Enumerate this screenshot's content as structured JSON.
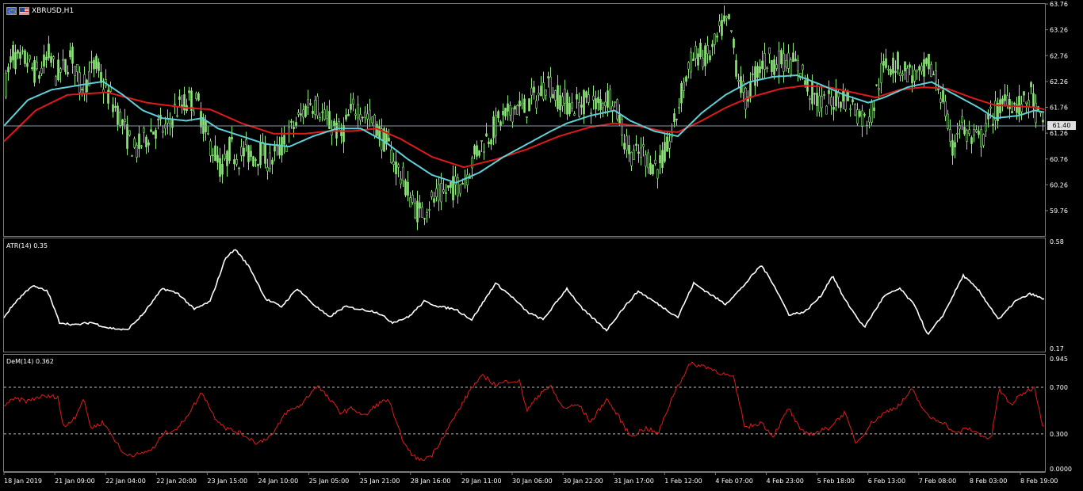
{
  "window": {
    "title": "XBRUSD,H1",
    "icons": [
      "chart-flag-eu-icon",
      "chart-flag-us-icon"
    ]
  },
  "colors": {
    "background": "#000000",
    "candles": "#8ee87a",
    "ma_fast": "#5fd0d8",
    "ma_slow": "#e01a1a",
    "atr": "#ffffff",
    "dem": "#e01a1a",
    "grid": "#7a7a7a",
    "axis_text": "#ffffff"
  },
  "price_panel": {
    "current_price": "61.40",
    "ticks": [
      "63.76",
      "63.26",
      "62.76",
      "62.26",
      "61.76",
      "61.26",
      "60.76",
      "60.26",
      "59.76"
    ]
  },
  "atr_panel": {
    "label": "ATR(14) 0.35",
    "ticks": [
      "0.58",
      "0.17"
    ]
  },
  "dem_panel": {
    "label": "DeM(14) 0.362",
    "ticks": [
      "0.945",
      "0.700",
      "0.300",
      "0.0000"
    ],
    "levels": [
      0.7,
      0.3
    ]
  },
  "time_axis": [
    "18 Jan 2019",
    "21 Jan 09:00",
    "22 Jan 04:00",
    "22 Jan 20:00",
    "23 Jan 15:00",
    "24 Jan 10:00",
    "25 Jan 05:00",
    "25 Jan 21:00",
    "28 Jan 16:00",
    "29 Jan 11:00",
    "30 Jan 06:00",
    "30 Jan 22:00",
    "31 Jan 17:00",
    "1 Feb 12:00",
    "4 Feb 07:00",
    "4 Feb 23:00",
    "5 Feb 18:00",
    "6 Feb 13:00",
    "7 Feb 08:00",
    "8 Feb 03:00",
    "8 Feb 19:00"
  ],
  "chart_data": {
    "type": "line",
    "price_axis": [
      59.76,
      63.76
    ],
    "price_anchors": [
      [
        0,
        61.6
      ],
      [
        8,
        62.3
      ],
      [
        16,
        62.8
      ],
      [
        24,
        62.6
      ],
      [
        32,
        62.7
      ],
      [
        40,
        62.5
      ],
      [
        48,
        62.4
      ],
      [
        56,
        62.6
      ],
      [
        62,
        62.8
      ],
      [
        70,
        62.4
      ],
      [
        80,
        62.5
      ],
      [
        90,
        62.8
      ],
      [
        100,
        62.2
      ],
      [
        110,
        62.3
      ],
      [
        120,
        62.6
      ],
      [
        130,
        62.2
      ],
      [
        140,
        61.9
      ],
      [
        150,
        61.6
      ],
      [
        160,
        61.2
      ],
      [
        170,
        60.9
      ],
      [
        180,
        61.1
      ],
      [
        190,
        61.3
      ],
      [
        200,
        61.4
      ],
      [
        210,
        61.3
      ],
      [
        220,
        61.7
      ],
      [
        230,
        61.8
      ],
      [
        240,
        61.9
      ],
      [
        250,
        61.8
      ],
      [
        260,
        61.2
      ],
      [
        270,
        60.9
      ],
      [
        280,
        60.5
      ],
      [
        290,
        61.0
      ],
      [
        300,
        60.8
      ],
      [
        310,
        60.9
      ],
      [
        320,
        60.8
      ],
      [
        330,
        60.9
      ],
      [
        340,
        60.7
      ],
      [
        350,
        60.9
      ],
      [
        360,
        61.1
      ],
      [
        370,
        61.4
      ],
      [
        380,
        61.6
      ],
      [
        390,
        61.9
      ],
      [
        400,
        61.8
      ],
      [
        410,
        61.5
      ],
      [
        420,
        61.4
      ],
      [
        430,
        61.2
      ],
      [
        440,
        61.6
      ],
      [
        450,
        61.8
      ],
      [
        460,
        61.6
      ],
      [
        470,
        61.5
      ],
      [
        480,
        61.2
      ],
      [
        490,
        61.0
      ],
      [
        500,
        60.6
      ],
      [
        510,
        60.3
      ],
      [
        520,
        59.9
      ],
      [
        530,
        59.7
      ],
      [
        540,
        59.9
      ],
      [
        550,
        60.0
      ],
      [
        560,
        60.1
      ],
      [
        570,
        60.2
      ],
      [
        580,
        60.3
      ],
      [
        590,
        60.5
      ],
      [
        600,
        60.9
      ],
      [
        610,
        61.1
      ],
      [
        620,
        61.3
      ],
      [
        630,
        61.5
      ],
      [
        640,
        61.6
      ],
      [
        650,
        61.8
      ],
      [
        660,
        61.7
      ],
      [
        670,
        61.9
      ],
      [
        680,
        62.0
      ],
      [
        690,
        62.3
      ],
      [
        700,
        62.0
      ],
      [
        710,
        61.9
      ],
      [
        720,
        61.8
      ],
      [
        730,
        61.8
      ],
      [
        740,
        61.9
      ],
      [
        750,
        61.8
      ],
      [
        760,
        61.9
      ],
      [
        770,
        62.0
      ],
      [
        780,
        61.6
      ],
      [
        790,
        61.0
      ],
      [
        800,
        60.8
      ],
      [
        810,
        60.9
      ],
      [
        820,
        60.7
      ],
      [
        830,
        60.6
      ],
      [
        840,
        60.9
      ],
      [
        850,
        61.4
      ],
      [
        860,
        62.1
      ],
      [
        870,
        62.6
      ],
      [
        880,
        62.8
      ],
      [
        890,
        62.7
      ],
      [
        900,
        62.9
      ],
      [
        910,
        63.3
      ],
      [
        920,
        63.4
      ],
      [
        930,
        62.4
      ],
      [
        940,
        61.9
      ],
      [
        950,
        62.3
      ],
      [
        960,
        62.6
      ],
      [
        970,
        62.7
      ],
      [
        980,
        62.6
      ],
      [
        990,
        62.7
      ],
      [
        1000,
        62.6
      ],
      [
        1010,
        62.5
      ],
      [
        1020,
        62.1
      ],
      [
        1030,
        61.9
      ],
      [
        1040,
        61.8
      ],
      [
        1050,
        61.9
      ],
      [
        1060,
        62.0
      ],
      [
        1070,
        61.9
      ],
      [
        1080,
        61.7
      ],
      [
        1090,
        61.5
      ],
      [
        1100,
        61.7
      ],
      [
        1110,
        62.4
      ],
      [
        1120,
        62.6
      ],
      [
        1130,
        62.6
      ],
      [
        1140,
        62.5
      ],
      [
        1150,
        62.4
      ],
      [
        1160,
        62.3
      ],
      [
        1170,
        62.6
      ],
      [
        1180,
        62.3
      ],
      [
        1190,
        61.9
      ],
      [
        1200,
        60.9
      ],
      [
        1210,
        61.5
      ],
      [
        1220,
        61.2
      ],
      [
        1230,
        61.1
      ],
      [
        1240,
        61.2
      ],
      [
        1250,
        61.6
      ],
      [
        1260,
        61.7
      ],
      [
        1270,
        62.0
      ],
      [
        1280,
        61.8
      ],
      [
        1290,
        61.8
      ],
      [
        1300,
        62.0
      ],
      [
        1310,
        61.5
      ],
      [
        1318,
        61.4
      ]
    ],
    "ma_fast_anchors": [
      [
        0,
        61.4
      ],
      [
        30,
        61.9
      ],
      [
        60,
        62.1
      ],
      [
        100,
        62.2
      ],
      [
        125,
        62.26
      ],
      [
        150,
        62.0
      ],
      [
        175,
        61.7
      ],
      [
        200,
        61.55
      ],
      [
        230,
        61.5
      ],
      [
        250,
        61.55
      ],
      [
        270,
        61.35
      ],
      [
        300,
        61.2
      ],
      [
        330,
        61.05
      ],
      [
        360,
        61.0
      ],
      [
        390,
        61.2
      ],
      [
        420,
        61.35
      ],
      [
        450,
        61.35
      ],
      [
        480,
        61.1
      ],
      [
        510,
        60.75
      ],
      [
        540,
        60.45
      ],
      [
        570,
        60.3
      ],
      [
        600,
        60.5
      ],
      [
        630,
        60.8
      ],
      [
        660,
        61.05
      ],
      [
        690,
        61.3
      ],
      [
        710,
        61.45
      ],
      [
        740,
        61.6
      ],
      [
        770,
        61.7
      ],
      [
        790,
        61.5
      ],
      [
        820,
        61.3
      ],
      [
        850,
        61.2
      ],
      [
        880,
        61.65
      ],
      [
        910,
        62.0
      ],
      [
        940,
        62.25
      ],
      [
        970,
        62.35
      ],
      [
        1000,
        62.38
      ],
      [
        1030,
        62.2
      ],
      [
        1060,
        62.0
      ],
      [
        1090,
        61.85
      ],
      [
        1110,
        61.95
      ],
      [
        1140,
        62.15
      ],
      [
        1170,
        62.25
      ],
      [
        1200,
        62.0
      ],
      [
        1230,
        61.75
      ],
      [
        1250,
        61.55
      ],
      [
        1280,
        61.6
      ],
      [
        1300,
        61.7
      ],
      [
        1318,
        61.65
      ]
    ],
    "ma_slow_anchors": [
      [
        0,
        61.1
      ],
      [
        40,
        61.7
      ],
      [
        80,
        62.0
      ],
      [
        130,
        62.05
      ],
      [
        180,
        61.85
      ],
      [
        230,
        61.75
      ],
      [
        260,
        61.72
      ],
      [
        300,
        61.45
      ],
      [
        340,
        61.25
      ],
      [
        380,
        61.25
      ],
      [
        410,
        61.3
      ],
      [
        440,
        61.3
      ],
      [
        470,
        61.35
      ],
      [
        500,
        61.15
      ],
      [
        540,
        60.8
      ],
      [
        580,
        60.6
      ],
      [
        620,
        60.75
      ],
      [
        660,
        60.95
      ],
      [
        700,
        61.2
      ],
      [
        740,
        61.38
      ],
      [
        770,
        61.45
      ],
      [
        800,
        61.4
      ],
      [
        830,
        61.3
      ],
      [
        850,
        61.28
      ],
      [
        880,
        61.5
      ],
      [
        910,
        61.75
      ],
      [
        940,
        61.95
      ],
      [
        980,
        62.12
      ],
      [
        1010,
        62.18
      ],
      [
        1040,
        62.15
      ],
      [
        1070,
        62.05
      ],
      [
        1100,
        61.95
      ],
      [
        1130,
        62.1
      ],
      [
        1160,
        62.15
      ],
      [
        1190,
        62.12
      ],
      [
        1220,
        61.95
      ],
      [
        1250,
        61.8
      ],
      [
        1280,
        61.78
      ],
      [
        1300,
        61.76
      ],
      [
        1318,
        61.7
      ]
    ],
    "atr_axis": [
      0.17,
      0.58
    ],
    "atr_anchors": [
      [
        0,
        0.29
      ],
      [
        15,
        0.35
      ],
      [
        35,
        0.41
      ],
      [
        55,
        0.39
      ],
      [
        70,
        0.27
      ],
      [
        90,
        0.26
      ],
      [
        110,
        0.27
      ],
      [
        130,
        0.25
      ],
      [
        155,
        0.24
      ],
      [
        175,
        0.3
      ],
      [
        200,
        0.4
      ],
      [
        220,
        0.38
      ],
      [
        240,
        0.32
      ],
      [
        260,
        0.35
      ],
      [
        280,
        0.52
      ],
      [
        292,
        0.55
      ],
      [
        310,
        0.48
      ],
      [
        330,
        0.36
      ],
      [
        350,
        0.33
      ],
      [
        370,
        0.4
      ],
      [
        390,
        0.34
      ],
      [
        410,
        0.29
      ],
      [
        430,
        0.33
      ],
      [
        450,
        0.32
      ],
      [
        470,
        0.31
      ],
      [
        490,
        0.27
      ],
      [
        510,
        0.29
      ],
      [
        530,
        0.35
      ],
      [
        550,
        0.33
      ],
      [
        570,
        0.32
      ],
      [
        590,
        0.28
      ],
      [
        620,
        0.42
      ],
      [
        640,
        0.37
      ],
      [
        660,
        0.31
      ],
      [
        680,
        0.28
      ],
      [
        710,
        0.4
      ],
      [
        730,
        0.32
      ],
      [
        760,
        0.24
      ],
      [
        780,
        0.32
      ],
      [
        800,
        0.39
      ],
      [
        830,
        0.33
      ],
      [
        850,
        0.29
      ],
      [
        870,
        0.42
      ],
      [
        890,
        0.38
      ],
      [
        910,
        0.34
      ],
      [
        930,
        0.4
      ],
      [
        955,
        0.49
      ],
      [
        970,
        0.42
      ],
      [
        990,
        0.3
      ],
      [
        1010,
        0.31
      ],
      [
        1030,
        0.37
      ],
      [
        1045,
        0.45
      ],
      [
        1060,
        0.36
      ],
      [
        1085,
        0.25
      ],
      [
        1110,
        0.37
      ],
      [
        1130,
        0.4
      ],
      [
        1150,
        0.33
      ],
      [
        1165,
        0.22
      ],
      [
        1185,
        0.3
      ],
      [
        1210,
        0.45
      ],
      [
        1230,
        0.39
      ],
      [
        1255,
        0.28
      ],
      [
        1275,
        0.35
      ],
      [
        1295,
        0.38
      ],
      [
        1318,
        0.35
      ]
    ],
    "dem_axis": [
      0.0,
      0.945
    ],
    "dem_anchors": [
      [
        0,
        0.55
      ],
      [
        15,
        0.6
      ],
      [
        30,
        0.58
      ],
      [
        45,
        0.62
      ],
      [
        68,
        0.62
      ],
      [
        75,
        0.35
      ],
      [
        90,
        0.45
      ],
      [
        100,
        0.6
      ],
      [
        110,
        0.35
      ],
      [
        125,
        0.4
      ],
      [
        140,
        0.25
      ],
      [
        150,
        0.13
      ],
      [
        170,
        0.12
      ],
      [
        190,
        0.18
      ],
      [
        200,
        0.3
      ],
      [
        220,
        0.35
      ],
      [
        240,
        0.55
      ],
      [
        250,
        0.66
      ],
      [
        265,
        0.45
      ],
      [
        280,
        0.35
      ],
      [
        300,
        0.3
      ],
      [
        320,
        0.22
      ],
      [
        340,
        0.3
      ],
      [
        355,
        0.48
      ],
      [
        375,
        0.55
      ],
      [
        395,
        0.72
      ],
      [
        410,
        0.6
      ],
      [
        425,
        0.48
      ],
      [
        440,
        0.52
      ],
      [
        455,
        0.45
      ],
      [
        470,
        0.55
      ],
      [
        485,
        0.6
      ],
      [
        495,
        0.38
      ],
      [
        510,
        0.15
      ],
      [
        525,
        0.07
      ],
      [
        540,
        0.12
      ],
      [
        560,
        0.35
      ],
      [
        575,
        0.52
      ],
      [
        590,
        0.7
      ],
      [
        605,
        0.8
      ],
      [
        620,
        0.72
      ],
      [
        640,
        0.76
      ],
      [
        650,
        0.75
      ],
      [
        660,
        0.5
      ],
      [
        680,
        0.68
      ],
      [
        690,
        0.7
      ],
      [
        705,
        0.52
      ],
      [
        725,
        0.55
      ],
      [
        740,
        0.4
      ],
      [
        760,
        0.6
      ],
      [
        775,
        0.45
      ],
      [
        790,
        0.28
      ],
      [
        810,
        0.35
      ],
      [
        825,
        0.3
      ],
      [
        845,
        0.65
      ],
      [
        865,
        0.9
      ],
      [
        885,
        0.88
      ],
      [
        905,
        0.82
      ],
      [
        920,
        0.78
      ],
      [
        935,
        0.35
      ],
      [
        955,
        0.4
      ],
      [
        970,
        0.28
      ],
      [
        990,
        0.52
      ],
      [
        1005,
        0.32
      ],
      [
        1020,
        0.3
      ],
      [
        1040,
        0.35
      ],
      [
        1060,
        0.48
      ],
      [
        1075,
        0.22
      ],
      [
        1095,
        0.4
      ],
      [
        1115,
        0.5
      ],
      [
        1130,
        0.55
      ],
      [
        1145,
        0.68
      ],
      [
        1165,
        0.45
      ],
      [
        1185,
        0.4
      ],
      [
        1200,
        0.3
      ],
      [
        1215,
        0.35
      ],
      [
        1230,
        0.3
      ],
      [
        1245,
        0.25
      ],
      [
        1255,
        0.68
      ],
      [
        1270,
        0.55
      ],
      [
        1285,
        0.65
      ],
      [
        1300,
        0.7
      ],
      [
        1310,
        0.38
      ],
      [
        1318,
        0.36
      ]
    ]
  }
}
